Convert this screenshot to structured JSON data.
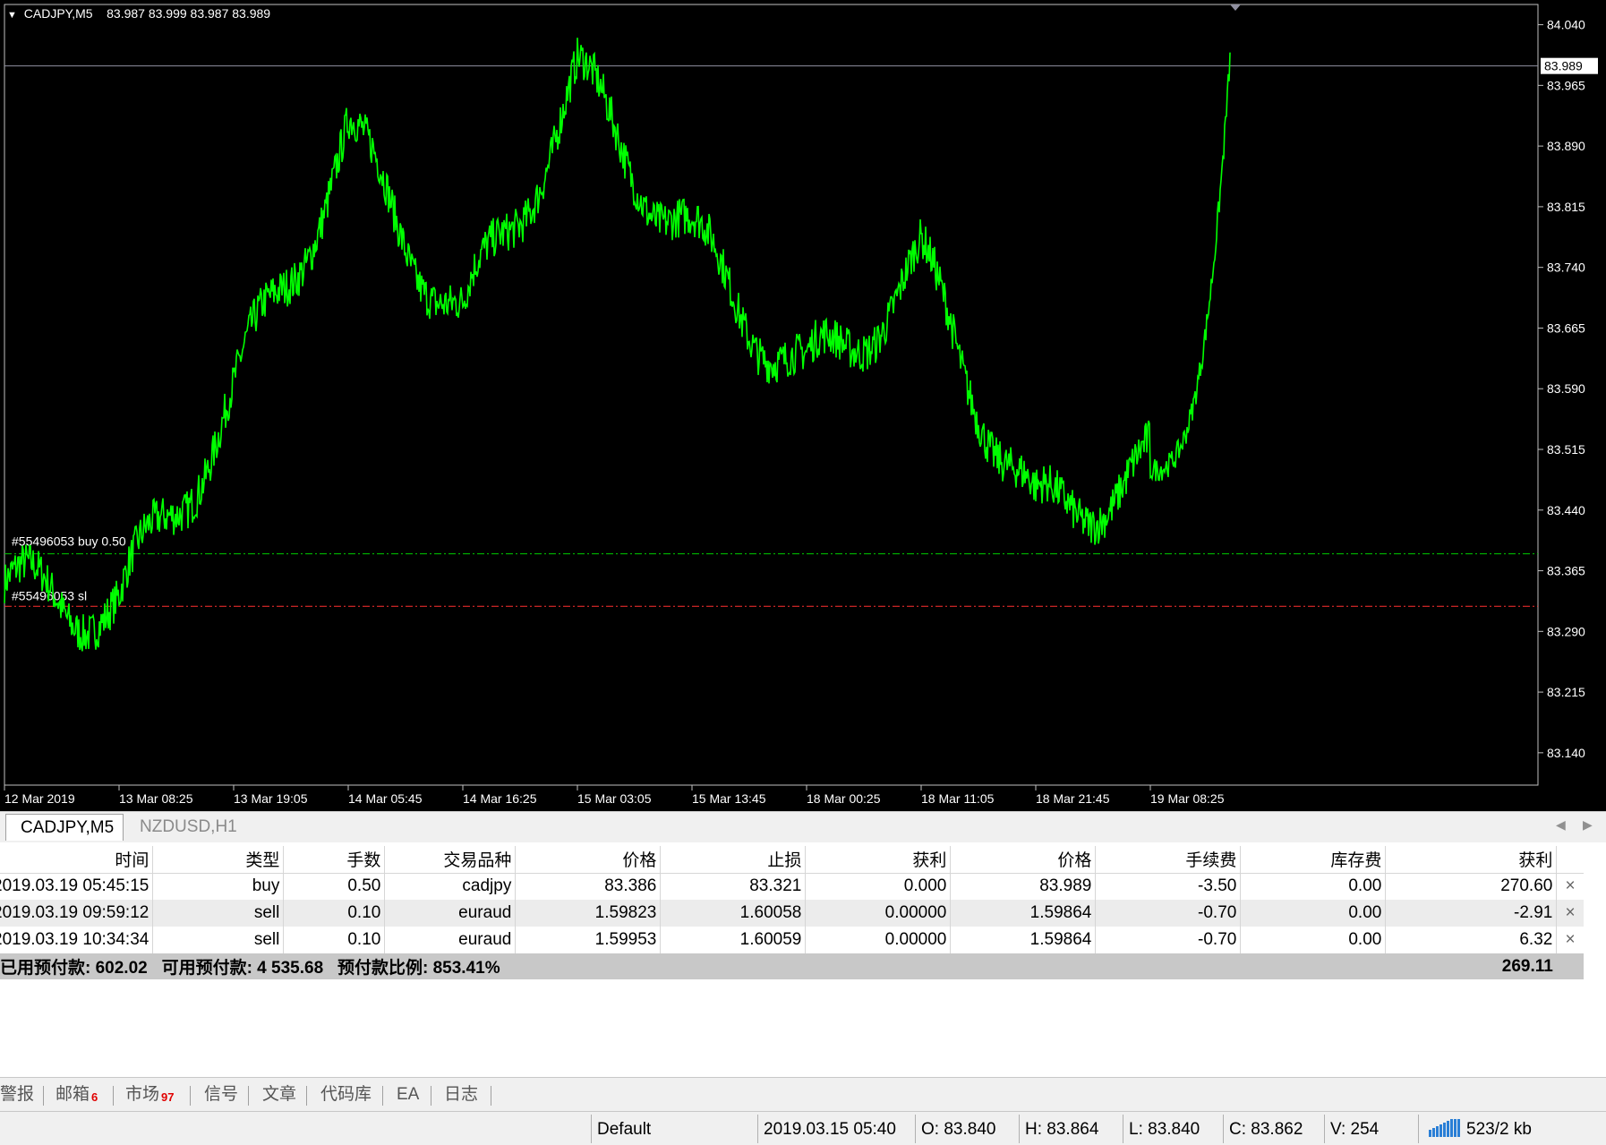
{
  "chart": {
    "symbol_timeframe": "CADJPY,M5",
    "ohlc_text": "83.987 83.999 83.987 83.989",
    "current_price_label": "83.989",
    "price_axis_ticks": [
      "84.040",
      "83.965",
      "83.890",
      "83.815",
      "83.740",
      "83.665",
      "83.590",
      "83.515",
      "83.440",
      "83.365",
      "83.290",
      "83.215",
      "83.140"
    ],
    "time_axis_ticks": [
      "12 Mar 2019",
      "13 Mar 08:25",
      "13 Mar 19:05",
      "14 Mar 05:45",
      "14 Mar 16:25",
      "15 Mar 03:05",
      "15 Mar 13:45",
      "18 Mar 00:25",
      "18 Mar 11:05",
      "18 Mar 21:45",
      "19 Mar 08:25"
    ],
    "order_label_buy": "#55496053 buy 0.50",
    "order_label_sl": "#55496053 sl",
    "line_color": "#00ff00",
    "background_color": "#000000"
  },
  "chart_data": {
    "type": "line",
    "title": "",
    "xlabel": "",
    "ylabel": "",
    "ylim": [
      83.1,
      84.065
    ],
    "series": [
      {
        "x": [
          "12 Mar 2019",
          "13 Mar 08:25",
          "13 Mar 19:05",
          "14 Mar 05:45",
          "14 Mar 16:25",
          "15 Mar 03:05",
          "15 Mar 13:45",
          "18 Mar 00:25",
          "18 Mar 11:05",
          "18 Mar 21:45",
          "19 Mar 08:25"
        ],
        "values": [
          83.34,
          83.32,
          83.58,
          83.9,
          83.67,
          83.97,
          83.77,
          83.6,
          83.74,
          83.43,
          83.49
        ]
      }
    ],
    "horizontal_lines": [
      {
        "label": "#55496053 buy 0.50",
        "value": 83.386,
        "color": "#00cc00"
      },
      {
        "label": "#55496053 sl",
        "value": 83.321,
        "color": "#ff3030"
      },
      {
        "label": "83.989",
        "value": 83.989,
        "color": "#9090a0"
      }
    ],
    "grid": false
  },
  "chart_tabs": [
    {
      "label": "CADJPY,M5",
      "active": true
    },
    {
      "label": "NZDUSD,H1",
      "active": false
    }
  ],
  "nav_icons": [
    "chevron-left-icon",
    "chevron-right-icon"
  ],
  "table": {
    "headers": [
      "时间",
      "类型",
      "手数",
      "交易品种",
      "价格",
      "止损",
      "获利",
      "价格",
      "手续费",
      "库存费",
      "获利"
    ],
    "rows": [
      [
        "2019.03.19 05:45:15",
        "buy",
        "0.50",
        "cadjpy",
        "83.386",
        "83.321",
        "0.000",
        "83.989",
        "-3.50",
        "0.00",
        "270.60"
      ],
      [
        "2019.03.19 09:59:12",
        "sell",
        "0.10",
        "euraud",
        "1.59823",
        "1.60058",
        "0.00000",
        "1.59864",
        "-0.70",
        "0.00",
        "-2.91"
      ],
      [
        "2019.03.19 10:34:34",
        "sell",
        "0.10",
        "euraud",
        "1.59953",
        "1.60059",
        "0.00000",
        "1.59864",
        "-0.70",
        "0.00",
        "6.32"
      ]
    ],
    "close_glyph": "×",
    "summary": {
      "margin": "已用预付款: 602.02",
      "free_margin": "可用预付款: 4 535.68",
      "margin_level": "预付款比例: 853.41%",
      "total_profit": "269.11"
    }
  },
  "bottom_tabs": [
    {
      "label": "警报"
    },
    {
      "label": "邮箱",
      "badge": "6"
    },
    {
      "label": "市场",
      "badge": "97"
    },
    {
      "label": "信号"
    },
    {
      "label": "文章"
    },
    {
      "label": "代码库"
    },
    {
      "label": "EA"
    },
    {
      "label": "日志"
    }
  ],
  "status_bar": {
    "profile": "Default",
    "datetime": "2019.03.15 05:40",
    "open": "O: 83.840",
    "high": "H: 83.864",
    "low": "L: 83.840",
    "close": "C: 83.862",
    "volume": "V: 254",
    "traffic": "523/2 kb"
  }
}
